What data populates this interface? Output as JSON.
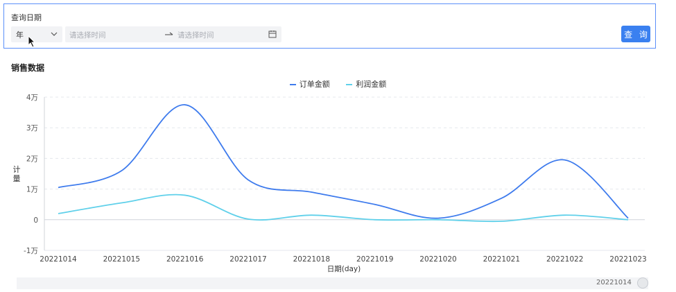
{
  "filter": {
    "label": "查询日期",
    "period_value": "年",
    "start_placeholder": "请选择时间",
    "end_placeholder": "请选择时间",
    "query_label": "查 询"
  },
  "section_title": "销售数据",
  "colors": {
    "accent": "#3a80f0",
    "series1": "#3e7bed",
    "series2": "#5fd0ea"
  },
  "chart_data": {
    "type": "line",
    "x": [
      "20221014",
      "20221015",
      "20221016",
      "20221017",
      "20221018",
      "20221019",
      "20221020",
      "20221021",
      "20221022",
      "20221023"
    ],
    "series": [
      {
        "name": "订单金额",
        "values": [
          10500,
          16000,
          37500,
          13000,
          9000,
          5000,
          500,
          7000,
          19500,
          500
        ]
      },
      {
        "name": "利润金额",
        "values": [
          2000,
          5500,
          8000,
          200,
          1500,
          0,
          0,
          -500,
          1500,
          0
        ]
      }
    ],
    "xlabel": "日期(day)",
    "ylabel": "计量",
    "ylim": [
      -10000,
      40000
    ],
    "yticks": [
      -10000,
      0,
      10000,
      20000,
      30000,
      40000
    ],
    "ytick_labels": [
      "-1万",
      "0",
      "1万",
      "2万",
      "3万",
      "4万"
    ],
    "grid": true,
    "legend": "top-center",
    "smooth": true
  },
  "zoom": {
    "label": "20221014"
  }
}
